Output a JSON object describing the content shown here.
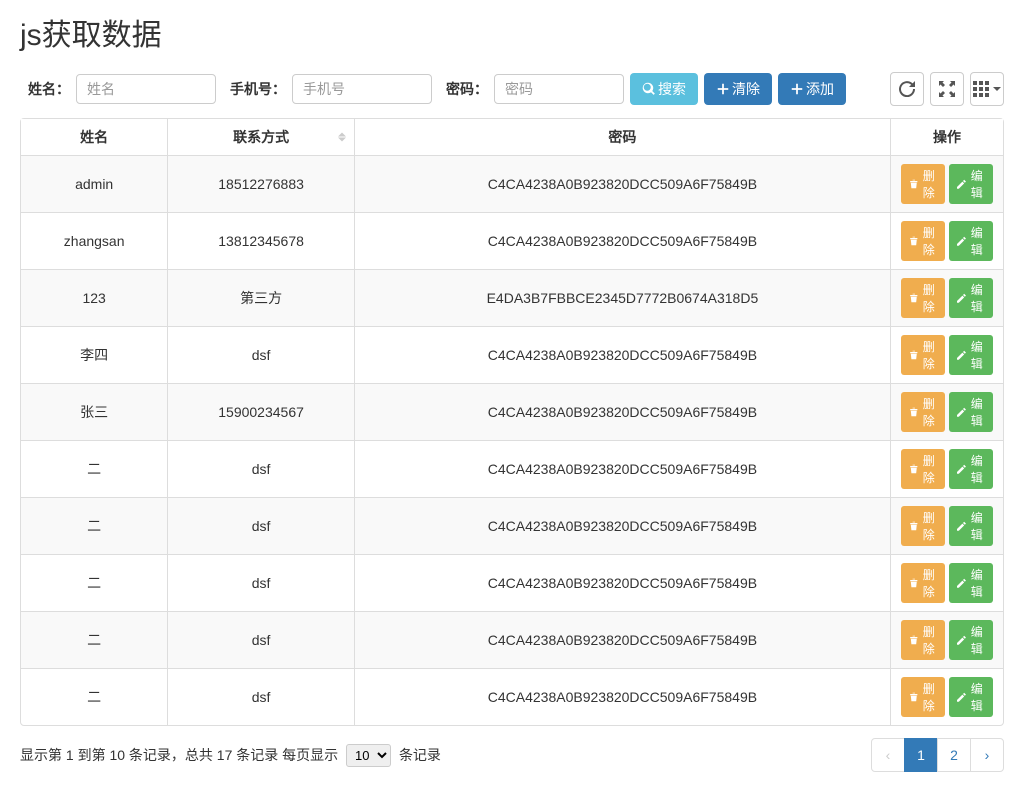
{
  "page": {
    "title": "js获取数据"
  },
  "search": {
    "name_label": "姓名：",
    "name_placeholder": "姓名",
    "phone_label": "手机号：",
    "phone_placeholder": "手机号",
    "password_label": "密码：",
    "password_placeholder": "密码",
    "search_btn": "搜索",
    "clear_btn": "清除",
    "add_btn": "添加"
  },
  "columns": {
    "name": "姓名",
    "contact": "联系方式",
    "password": "密码",
    "ops": "操作"
  },
  "row_actions": {
    "delete": "删除",
    "edit": "编辑"
  },
  "rows": [
    {
      "name": "admin",
      "contact": "18512276883",
      "password": "C4CA4238A0B923820DCC509A6F75849B"
    },
    {
      "name": "zhangsan",
      "contact": "13812345678",
      "password": "C4CA4238A0B923820DCC509A6F75849B"
    },
    {
      "name": "123",
      "contact": "第三方",
      "password": "E4DA3B7FBBCE2345D7772B0674A318D5"
    },
    {
      "name": "李四",
      "contact": "dsf",
      "password": "C4CA4238A0B923820DCC509A6F75849B"
    },
    {
      "name": "张三",
      "contact": "15900234567",
      "password": "C4CA4238A0B923820DCC509A6F75849B"
    },
    {
      "name": "二",
      "contact": "dsf",
      "password": "C4CA4238A0B923820DCC509A6F75849B"
    },
    {
      "name": "二",
      "contact": "dsf",
      "password": "C4CA4238A0B923820DCC509A6F75849B"
    },
    {
      "name": "二",
      "contact": "dsf",
      "password": "C4CA4238A0B923820DCC509A6F75849B"
    },
    {
      "name": "二",
      "contact": "dsf",
      "password": "C4CA4238A0B923820DCC509A6F75849B"
    },
    {
      "name": "二",
      "contact": "dsf",
      "password": "C4CA4238A0B923820DCC509A6F75849B"
    }
  ],
  "footer": {
    "info_prefix": "显示第 1 到第 10 条记录，总共 17 条记录 每页显示 ",
    "page_size": "10",
    "info_suffix": " 条记录"
  },
  "pagination": {
    "current": "1",
    "next": "2"
  }
}
